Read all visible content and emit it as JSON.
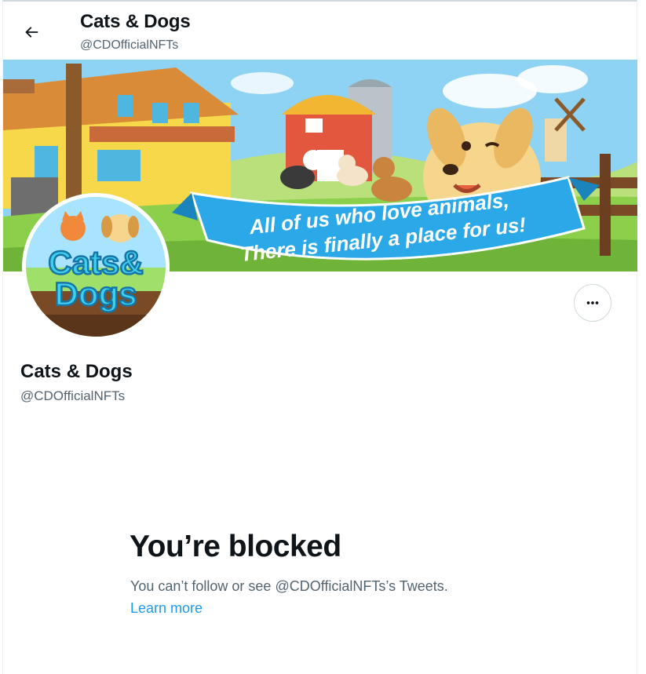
{
  "header": {
    "title": "Cats & Dogs",
    "handle": "@CDOfficialNFTs",
    "back_icon": "arrow-left-icon"
  },
  "banner": {
    "slogan_line1": "All of us who love animals,",
    "slogan_line2": "There is finally a place for us!",
    "colors": {
      "sky": "#8fd3f4",
      "ribbon": "#2aa8e8",
      "grass": "#8ccf4a"
    }
  },
  "avatar": {
    "logo_line1": "Cats&",
    "logo_line2": "Dogs"
  },
  "profile": {
    "name": "Cats & Dogs",
    "handle": "@CDOfficialNFTs",
    "more_icon": "more-horizontal-icon"
  },
  "blocked": {
    "title": "You’re blocked",
    "description": "You can’t follow or see @CDOfficialNFTs’s Tweets.",
    "link": "Learn more"
  },
  "theme": {
    "accent": "#1d9bf0",
    "text_primary": "#0f1419",
    "text_secondary": "#536471"
  }
}
